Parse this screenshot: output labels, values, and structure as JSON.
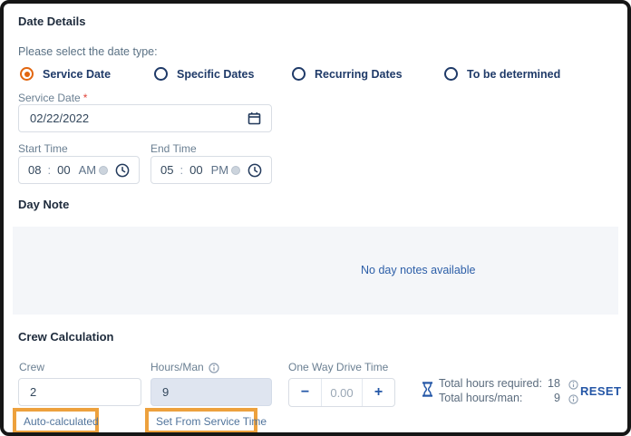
{
  "date_details": {
    "title": "Date Details",
    "prompt": "Please select the date type:",
    "radio_options": [
      {
        "label": "Service Date",
        "selected": true
      },
      {
        "label": "Specific Dates",
        "selected": false
      },
      {
        "label": "Recurring Dates",
        "selected": false
      },
      {
        "label": "To be determined",
        "selected": false
      }
    ],
    "service_date": {
      "label": "Service Date",
      "required_marker": "*",
      "value": "02/22/2022"
    },
    "start_time": {
      "label": "Start Time",
      "hour": "08",
      "separator": ":",
      "minute": "00",
      "meridiem": "AM"
    },
    "end_time": {
      "label": "End Time",
      "hour": "05",
      "separator": ":",
      "minute": "00",
      "meridiem": "PM"
    }
  },
  "day_note": {
    "title": "Day Note",
    "empty_message": "No day notes available"
  },
  "crew_calculation": {
    "title": "Crew Calculation",
    "crew": {
      "label": "Crew",
      "value": "2",
      "annotation": "Auto-calculated"
    },
    "hours_man": {
      "label": "Hours/Man",
      "value": "9",
      "annotation": "Set From Service Time"
    },
    "one_way_drive_time": {
      "label": "One Way Drive Time",
      "minus_glyph": "−",
      "placeholder": "0.00",
      "plus_glyph": "+"
    },
    "totals": [
      {
        "label": "Total hours required:",
        "value": "18"
      },
      {
        "label": "Total hours/man:",
        "value": "9"
      }
    ],
    "reset_label": "RESET"
  },
  "colors": {
    "accent_orange": "#e2660f",
    "annotation_orange": "#eda13d",
    "accent_blue": "#2457a7",
    "heading": "#1e2b3c",
    "label": "#6a7f92",
    "panel_bg": "#f4f6f9"
  }
}
